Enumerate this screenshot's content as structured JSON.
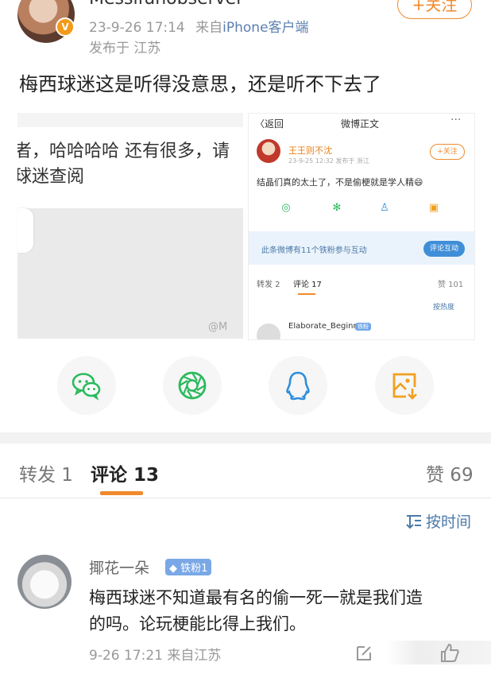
{
  "post": {
    "username": "Messifunobserver",
    "time": "23-9-26 17:14",
    "source_prefix": "来自",
    "source": "iPhone客户端",
    "location": "发布于 江苏",
    "follow_label": "+关注",
    "verified_badge": "V",
    "text": "梅西球迷这是听得没意思，还是听不下去了"
  },
  "image_left": {
    "line1": "者，哈哈哈哈 还有很多，请",
    "line2": "球迷查阅",
    "watermark": "@M"
  },
  "image_right": {
    "back": "〈返回",
    "title": "微博正文",
    "more": "···",
    "author": "王王则不沈",
    "meta": "23-9-25 12:32  发布于 浙江",
    "follow": "+关注",
    "text": "结晶们真的太土了，不是偷梗就是学人精😄",
    "fan_notice": "此条微博有11个铁粉参与互动",
    "fan_button": "评论互动",
    "repost_tab": "转发 2",
    "comment_tab": "评论 17",
    "like_tab": "赞 101",
    "sort": "按热度",
    "comment_author": "Elaborate_Beginner",
    "comment_badge": "铁粉"
  },
  "share_icons": [
    "wechat-icon",
    "moments-icon",
    "qq-icon",
    "save-image-icon"
  ],
  "tabs": {
    "repost": "转发 1",
    "comment": "评论 13",
    "like": "赞 69"
  },
  "sort_label": "按时间",
  "comment": {
    "author": "揶花一朵",
    "badge": "铁粉1",
    "line1": "梅西球迷不知道最有名的偷一死一就是我们造",
    "line2": "的吗。论玩梗能比得上我们。",
    "meta": "9-26 17:21 来自江苏"
  },
  "colors": {
    "accent": "#f08a2c",
    "link": "#4b79a8",
    "wechat": "#2bba5c",
    "qq": "#2f8fdc",
    "save": "#f0a020"
  }
}
